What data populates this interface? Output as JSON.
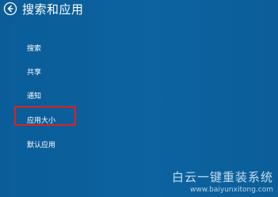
{
  "header": {
    "title": "搜索和应用",
    "back_icon": "back-arrow-icon"
  },
  "menu": {
    "items": [
      {
        "label": "搜索"
      },
      {
        "label": "共享"
      },
      {
        "label": "通知"
      },
      {
        "label": "应用大小"
      },
      {
        "label": "默认应用"
      }
    ],
    "selected_index": 3
  },
  "watermark": {
    "text": "白云一键重装系统",
    "url": "www.baiyunxitong.com"
  },
  "colors": {
    "background": "#0b5f9a",
    "text": "#ffffff",
    "highlight_border": "#e02020"
  }
}
